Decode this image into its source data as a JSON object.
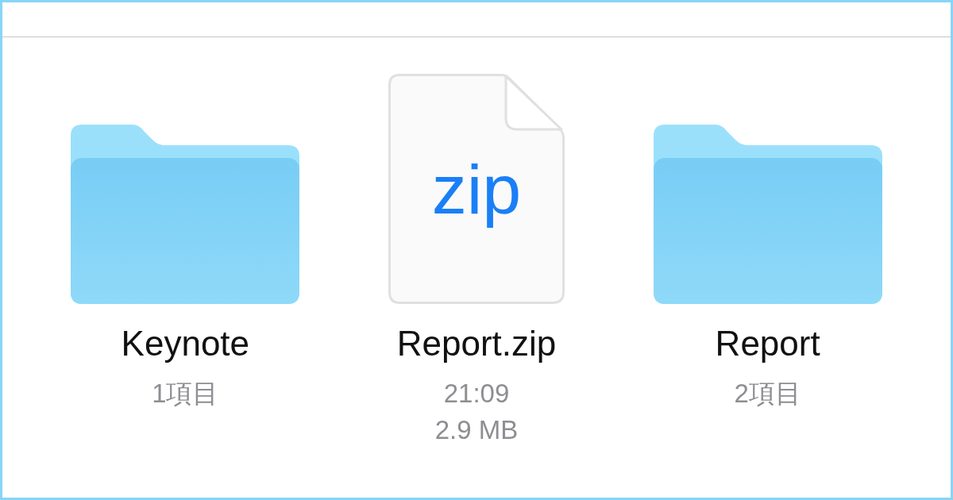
{
  "items": [
    {
      "kind": "folder",
      "name": "Keynote",
      "details": [
        "1項目"
      ]
    },
    {
      "kind": "file",
      "badge": "zip",
      "name": "Report.zip",
      "details": [
        "21:09",
        "2.9 MB"
      ]
    },
    {
      "kind": "folder",
      "name": "Report",
      "details": [
        "2項目"
      ]
    }
  ]
}
